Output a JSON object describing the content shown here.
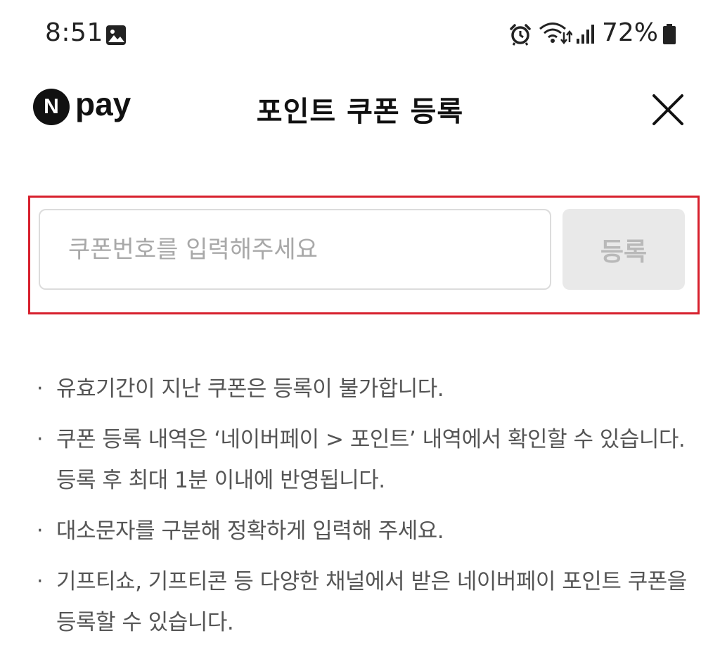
{
  "status_bar": {
    "time": "8:51",
    "battery_percent": "72%",
    "icons": [
      "gallery-icon",
      "alarm-icon",
      "wifi-icon",
      "signal-icon",
      "battery-icon"
    ]
  },
  "header": {
    "logo_letter": "N",
    "logo_text": "pay",
    "title": "포인트 쿠폰 등록",
    "close_icon": "close-icon"
  },
  "coupon_form": {
    "input_placeholder": "쿠폰번호를 입력해주세요",
    "input_value": "",
    "register_label": "등록",
    "highlight_color": "#d7202d"
  },
  "notices": [
    {
      "text": "유효기간이 지난 쿠폰은 등록이 불가합니다."
    },
    {
      "text": "쿠폰 등록 내역은 ‘네이버페이 > 포인트’ 내역에서 확인할 수 있습니다. 등록 후 최대 1분 이내에 반영됩니다."
    },
    {
      "text": "대소문자를 구분해 정확하게 입력해 주세요."
    },
    {
      "text": "기프티쇼, 기프티콘 등 다양한 채널에서 받은 네이버페이 포인트 쿠폰을 등록할 수 있습니다."
    }
  ]
}
